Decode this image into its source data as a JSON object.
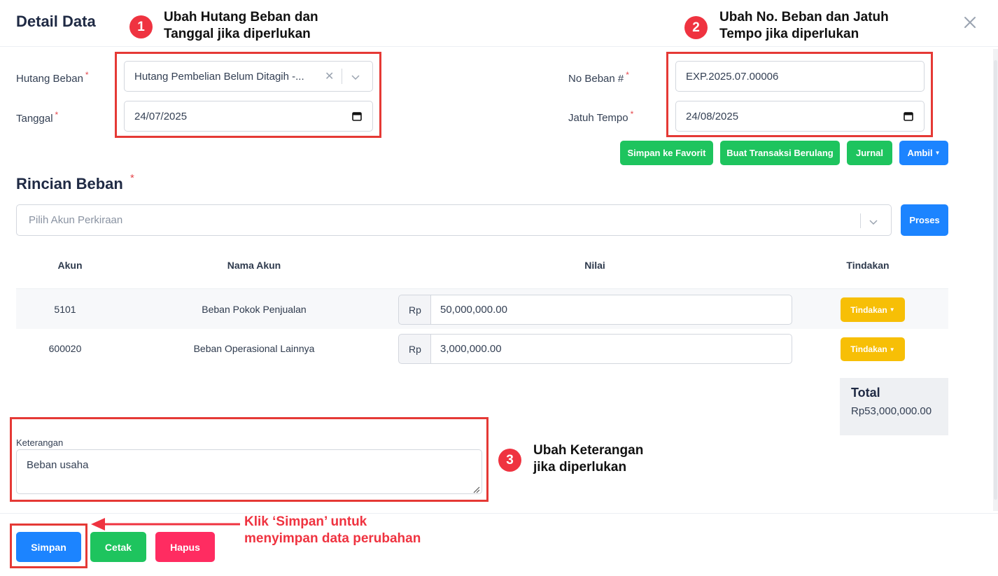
{
  "header": {
    "title": "Detail Data"
  },
  "form": {
    "hutang_beban_label": "Hutang Beban",
    "hutang_beban_value": "Hutang Pembelian Belum Ditagih -...",
    "tanggal_label": "Tanggal",
    "tanggal_value": "24/07/2025",
    "no_beban_label": "No Beban #",
    "no_beban_value": "EXP.2025.07.00006",
    "jatuh_tempo_label": "Jatuh Tempo",
    "jatuh_tempo_value": "24/08/2025",
    "required_mark": "*"
  },
  "actions": {
    "favorit": "Simpan ke Favorit",
    "berulang": "Buat Transaksi Berulang",
    "jurnal": "Jurnal",
    "ambil": "Ambil"
  },
  "rincian": {
    "title": "Rincian Beban",
    "akun_placeholder": "Pilih Akun Perkiraan",
    "proses": "Proses",
    "columns": {
      "akun": "Akun",
      "nama_akun": "Nama Akun",
      "nilai": "Nilai",
      "tindakan": "Tindakan"
    },
    "rows": [
      {
        "akun": "5101",
        "nama_akun": "Beban Pokok Penjualan",
        "currency": "Rp",
        "nilai": "50,000,000.00",
        "tindakan": "Tindakan"
      },
      {
        "akun": "600020",
        "nama_akun": "Beban Operasional Lainnya",
        "currency": "Rp",
        "nilai": "3,000,000.00",
        "tindakan": "Tindakan"
      }
    ],
    "total_label": "Total",
    "total_value": "Rp53,000,000.00"
  },
  "keterangan": {
    "label": "Keterangan",
    "value": "Beban usaha"
  },
  "footer": {
    "simpan": "Simpan",
    "cetak": "Cetak",
    "hapus": "Hapus"
  },
  "annotations": {
    "badge1": "1",
    "note1_line1": "Ubah Hutang Beban dan",
    "note1_line2": "Tanggal jika diperlukan",
    "badge2": "2",
    "note2_line1": "Ubah No. Beban dan Jatuh",
    "note2_line2": "Tempo jika diperlukan",
    "badge3": "3",
    "note3_line1": "Ubah Keterangan",
    "note3_line2": "jika diperlukan",
    "note4_line1": "Klik ‘Simpan’ untuk",
    "note4_line2": "menyimpan data perubahan"
  },
  "colors": {
    "primary": "#1c84ff",
    "success": "#1ec45e",
    "warning": "#f7bf06",
    "danger": "#ff2c61",
    "annotation": "#ef3340"
  }
}
